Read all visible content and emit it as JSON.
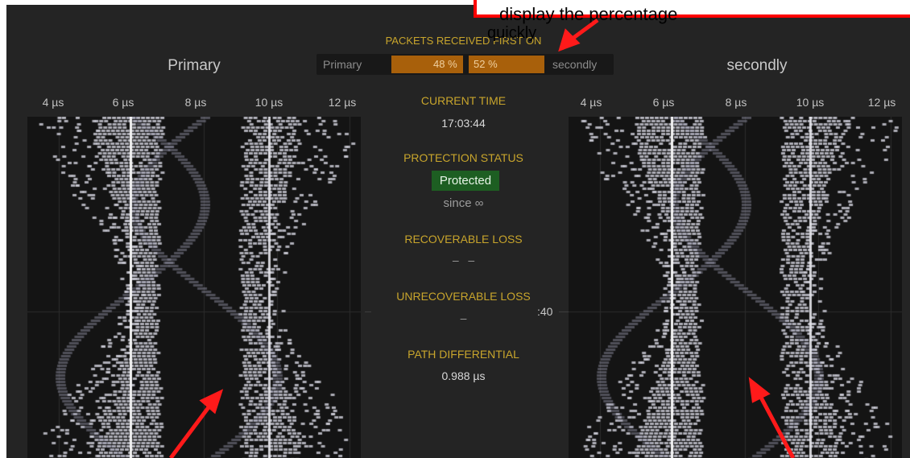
{
  "left_panel": {
    "title": "Primary",
    "axis_ticks": [
      "4 µs",
      "6 µs",
      "8 µs",
      "10 µs",
      "12 µs"
    ]
  },
  "right_panel": {
    "title": "secondly",
    "axis_ticks": [
      "4 µs",
      "6 µs",
      "8 µs",
      "10 µs",
      "12 µs"
    ]
  },
  "packets_received": {
    "title": "PACKETS RECEIVED FIRST ON",
    "left_label": "Primary",
    "left_percent": "48 %",
    "left_fraction": 0.48,
    "right_label": "secondly",
    "right_percent": "52 %",
    "right_fraction": 0.52
  },
  "current_time": {
    "title": "CURRENT TIME",
    "value": "17:03:44"
  },
  "protection_status": {
    "title": "PROTECTION STATUS",
    "value": "Protected",
    "since": "since ∞"
  },
  "recoverable_loss": {
    "title": "RECOVERABLE LOSS",
    "value": "–   –"
  },
  "unrecoverable_loss": {
    "title": "UNRECOVERABLE LOSS",
    "value": "–"
  },
  "path_differential": {
    "title": "PATH DIFFERENTIAL",
    "value": "0.988 µs"
  },
  "timeline_marker": ":40",
  "annotation": {
    "callout_text": "display the percentage",
    "callout_word": "quickly"
  },
  "colors": {
    "accent_gold": "#c8a52c",
    "bar_orange": "#a8600b",
    "protected_green": "#1d5e22",
    "annotation_red": "#ff0000"
  }
}
